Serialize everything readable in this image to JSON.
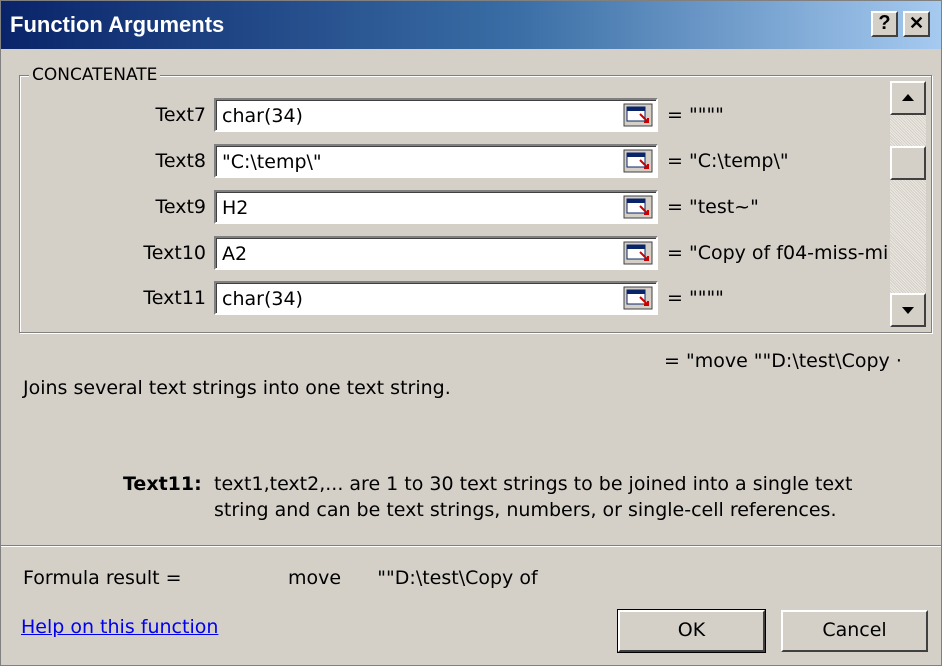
{
  "window": {
    "title": "Function Arguments",
    "help_glyph": "?",
    "close_glyph": "✕"
  },
  "function": {
    "name": "CONCATENATE"
  },
  "args": [
    {
      "label": "Text7",
      "value": "char(34)",
      "evaluated": "= \"\"\"\""
    },
    {
      "label": "Text8",
      "value": "\"C:\\temp\\\"",
      "evaluated": "= \"C:\\temp\\\""
    },
    {
      "label": "Text9",
      "value": "H2",
      "evaluated": "= \"test~\""
    },
    {
      "label": "Text10",
      "value": "A2",
      "evaluated": "= \"Copy of f04-miss-mi"
    },
    {
      "label": "Text11",
      "value": "char(34)",
      "evaluated": "= \"\"\"\""
    }
  ],
  "result_preview": "= \"move      \"\"D:\\test\\Copy ·",
  "description": "Joins several text strings into one text string.",
  "arg_help": {
    "name": "Text11:",
    "line1": "text1,text2,... are 1 to 30 text strings to be joined into a single text",
    "line2": "string and can be text strings, numbers, or single-cell references."
  },
  "formula_result": {
    "label": "Formula result =",
    "value": "move      \"\"D:\\test\\Copy of"
  },
  "help_link": "Help on this function",
  "buttons": {
    "ok": "OK",
    "cancel": "Cancel"
  }
}
